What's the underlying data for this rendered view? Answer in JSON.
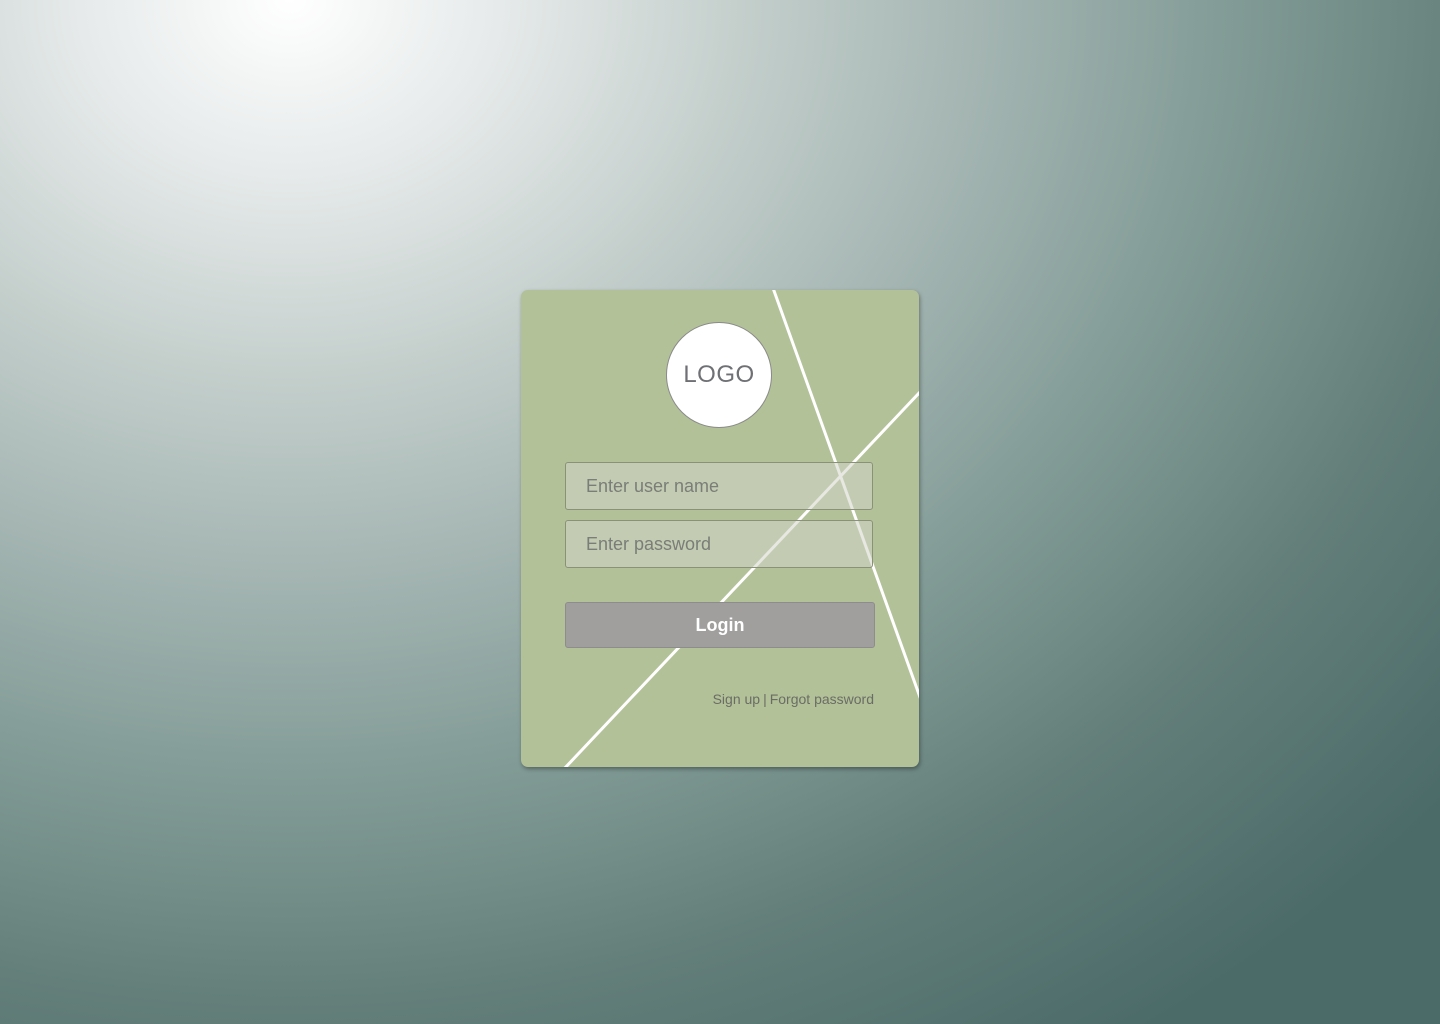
{
  "logo": {
    "text": "LOGO"
  },
  "form": {
    "username_placeholder": "Enter user name",
    "username_value": "",
    "password_placeholder": "Enter password",
    "password_value": "",
    "login_label": "Login"
  },
  "links": {
    "signup": "Sign up",
    "separator": "|",
    "forgot": "Forgot password"
  },
  "colors": {
    "card": "#b2c197",
    "button": "#a09f9d",
    "logo_circle": "#ffffff",
    "background_light": "#ffffff",
    "background_dark": "#4b6b69"
  }
}
